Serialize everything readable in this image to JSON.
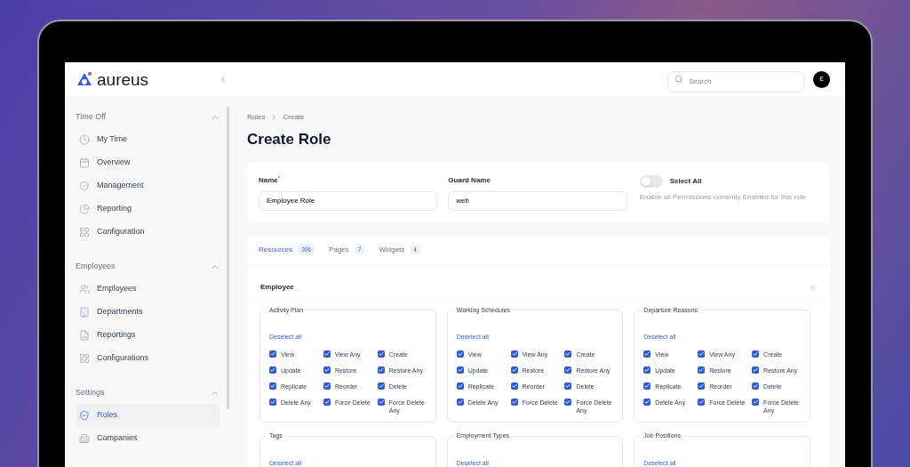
{
  "brand": {
    "name": "aureus"
  },
  "search": {
    "placeholder": "Search"
  },
  "user": {
    "initial": "E"
  },
  "sidebar": {
    "groups": [
      {
        "title": "Time Off",
        "expanded": true,
        "items": [
          {
            "label": "My Time",
            "selected": false
          },
          {
            "label": "Overview",
            "selected": false
          },
          {
            "label": "Management",
            "selected": false
          },
          {
            "label": "Reporting",
            "selected": false
          },
          {
            "label": "Configuration",
            "selected": false
          }
        ]
      },
      {
        "title": "Employees",
        "expanded": true,
        "items": [
          {
            "label": "Employees",
            "selected": false
          },
          {
            "label": "Departments",
            "selected": false
          },
          {
            "label": "Reportings",
            "selected": false
          },
          {
            "label": "Configurations",
            "selected": false
          }
        ]
      },
      {
        "title": "Settings",
        "expanded": true,
        "items": [
          {
            "label": "Roles",
            "selected": true
          },
          {
            "label": "Companies",
            "selected": false
          }
        ]
      }
    ]
  },
  "breadcrumbs": [
    "Roles",
    "Create"
  ],
  "page_title": "Create Role",
  "form": {
    "name": {
      "label": "Name",
      "required_mark": "*",
      "value": "Employee Role"
    },
    "guard_name": {
      "label": "Guard Name",
      "value": "web"
    },
    "select_all": {
      "label": "Select All",
      "on": false,
      "hint": "Enable all Permissions currently Enabled for this role"
    }
  },
  "tabs": [
    {
      "label": "Resources",
      "count": "306",
      "selected": true
    },
    {
      "label": "Pages",
      "count": "7",
      "selected": false
    },
    {
      "label": "Widgets",
      "count": "4",
      "selected": false
    }
  ],
  "section": {
    "title": "Employee",
    "expanded": true,
    "groups": [
      {
        "title": "Activity Plan",
        "action": "Deselect all",
        "permissions": [
          {
            "label": "View",
            "checked": true
          },
          {
            "label": "View Any",
            "checked": true
          },
          {
            "label": "Create",
            "checked": true
          },
          {
            "label": "Update",
            "checked": true
          },
          {
            "label": "Restore",
            "checked": true
          },
          {
            "label": "Restore Any",
            "checked": true
          },
          {
            "label": "Replicate",
            "checked": true
          },
          {
            "label": "Reorder",
            "checked": true
          },
          {
            "label": "Delete",
            "checked": true
          },
          {
            "label": "Delete Any",
            "checked": true
          },
          {
            "label": "Force Delete",
            "checked": true
          },
          {
            "label": "Force Delete Any",
            "checked": true
          }
        ]
      },
      {
        "title": "Working Schedules",
        "action": "Deselect all",
        "permissions": [
          {
            "label": "View",
            "checked": true
          },
          {
            "label": "View Any",
            "checked": true
          },
          {
            "label": "Create",
            "checked": true
          },
          {
            "label": "Update",
            "checked": true
          },
          {
            "label": "Restore",
            "checked": true
          },
          {
            "label": "Restore Any",
            "checked": true
          },
          {
            "label": "Replicate",
            "checked": true
          },
          {
            "label": "Reorder",
            "checked": true
          },
          {
            "label": "Delete",
            "checked": true
          },
          {
            "label": "Delete Any",
            "checked": true
          },
          {
            "label": "Force Delete",
            "checked": true
          },
          {
            "label": "Force Delete Any",
            "checked": true
          }
        ]
      },
      {
        "title": "Departure Reasons",
        "action": "Deselect all",
        "permissions": [
          {
            "label": "View",
            "checked": true
          },
          {
            "label": "View Any",
            "checked": true
          },
          {
            "label": "Create",
            "checked": true
          },
          {
            "label": "Update",
            "checked": true
          },
          {
            "label": "Restore",
            "checked": true
          },
          {
            "label": "Restore Any",
            "checked": true
          },
          {
            "label": "Replicate",
            "checked": true
          },
          {
            "label": "Reorder",
            "checked": true
          },
          {
            "label": "Delete",
            "checked": true
          },
          {
            "label": "Delete Any",
            "checked": true
          },
          {
            "label": "Force Delete",
            "checked": true
          },
          {
            "label": "Force Delete Any",
            "checked": true
          }
        ]
      },
      {
        "title": "Tags",
        "action": "Deselect all"
      },
      {
        "title": "Employment Types",
        "action": "Deselect all"
      },
      {
        "title": "Job Positions",
        "action": "Deselect all"
      }
    ]
  }
}
